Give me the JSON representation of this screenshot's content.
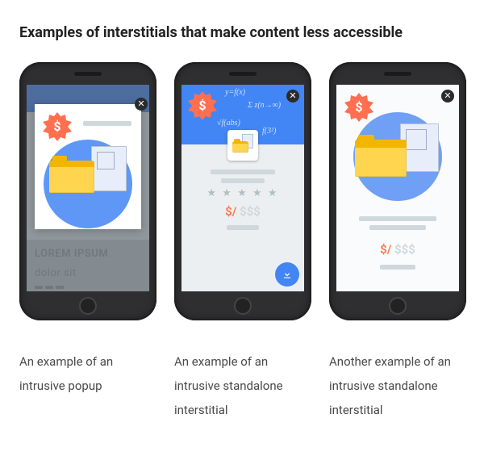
{
  "title": "Examples of interstitials that make content less accessible",
  "examples": [
    {
      "caption": "An example of an intrusive popup"
    },
    {
      "caption": "An example of an intrusive standalone interstitial"
    },
    {
      "caption": "Another example of an intrusive standalone interstitial"
    }
  ],
  "card": {
    "stars": "★ ★ ★ ★ ★",
    "price_prefix": "$/",
    "price_suffix": " $$$",
    "lorem_line1": "LOREM IPSUM",
    "lorem_line2": "dolor sit"
  },
  "icons": {
    "badge": "dollar-badge-icon",
    "close": "close-icon",
    "download": "download-icon",
    "folder": "folder-icon",
    "document": "document-icon"
  }
}
